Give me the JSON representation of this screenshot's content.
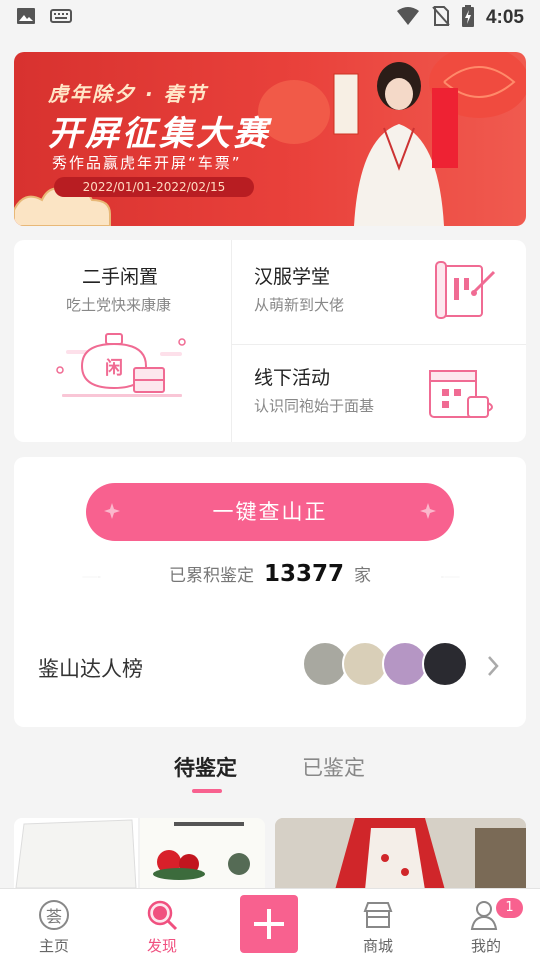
{
  "status_bar": {
    "time": "4:05"
  },
  "banner": {
    "line1": "虎年除夕 · 春节",
    "line2": "开屏征集大赛",
    "line3": "秀作品赢虎年开屏“车票”",
    "date_range": "2022/01/01-2022/02/15"
  },
  "features": [
    {
      "title": "二手闲置",
      "subtitle": "吃土党快来康康",
      "icon": "idle-trade-icon",
      "icon_label": "闲"
    },
    {
      "title": "汉服学堂",
      "subtitle": "从萌新到大佬",
      "icon": "scroll-brush-icon"
    },
    {
      "title": "线下活动",
      "subtitle": "认识同袍始于面基",
      "icon": "calendar-cup-icon"
    }
  ],
  "appraisal": {
    "button_label": "一键查山正",
    "stats_prefix": "已累积鉴定",
    "count": "13377",
    "stats_unit": "家"
  },
  "ranking": {
    "title": "鉴山达人榜",
    "avatar_colors": [
      "#a8a8a0",
      "#d9cfb8",
      "#b596c4",
      "#2a2a30"
    ]
  },
  "tabs": [
    {
      "label": "待鉴定",
      "active": true
    },
    {
      "label": "已鉴定",
      "active": false
    }
  ],
  "bottom_nav": [
    {
      "label": "主页",
      "icon": "home-logo-icon",
      "active": false
    },
    {
      "label": "发现",
      "icon": "discover-icon",
      "active": true
    },
    {
      "label": "",
      "icon": "plus-icon",
      "active": false
    },
    {
      "label": "商城",
      "icon": "shop-icon",
      "active": false
    },
    {
      "label": "我的",
      "icon": "profile-icon",
      "active": false
    }
  ],
  "home_icon_glyph": "荟",
  "profile_badge": "1",
  "colors": {
    "accent": "#f8618f",
    "banner_red": "#e23a36",
    "text_muted": "#888888"
  }
}
